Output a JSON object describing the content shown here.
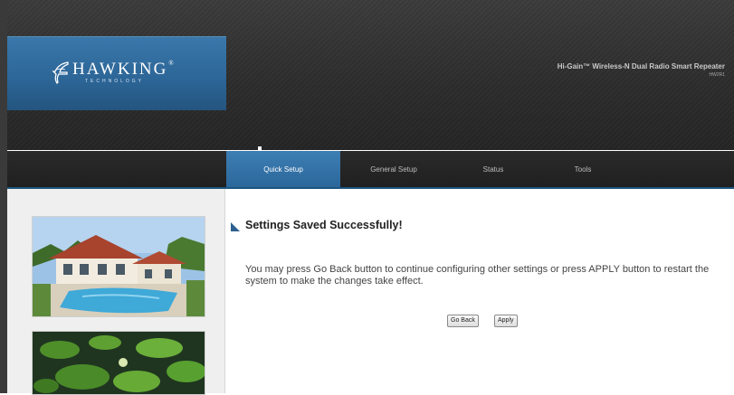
{
  "header": {
    "logo_text": "HAWKING",
    "logo_reg": "®",
    "logo_subtext": "TECHNOLOGY",
    "product_title": "Hi-Gain™ Wireless-N Dual Radio Smart Repeater",
    "model_number": "HW2R1"
  },
  "nav": {
    "tabs": [
      {
        "label": "Quick Setup",
        "active": true
      },
      {
        "label": "General Setup",
        "active": false
      },
      {
        "label": "Status",
        "active": false
      },
      {
        "label": "Tools",
        "active": false
      }
    ]
  },
  "main": {
    "title": "Settings Saved Successfully!",
    "message": "You may press Go Back button to continue configuring other settings or press APPLY button to restart the system to make the changes take effect.",
    "go_back_label": "Go Back",
    "apply_label": "Apply"
  },
  "colors": {
    "accent": "#2c6596",
    "header_bg": "#2c2c2c",
    "sidebar_bg": "#efefef"
  },
  "icons": {
    "title_marker": "triangle-arrow-icon",
    "logo": "hawk-logo-icon"
  }
}
